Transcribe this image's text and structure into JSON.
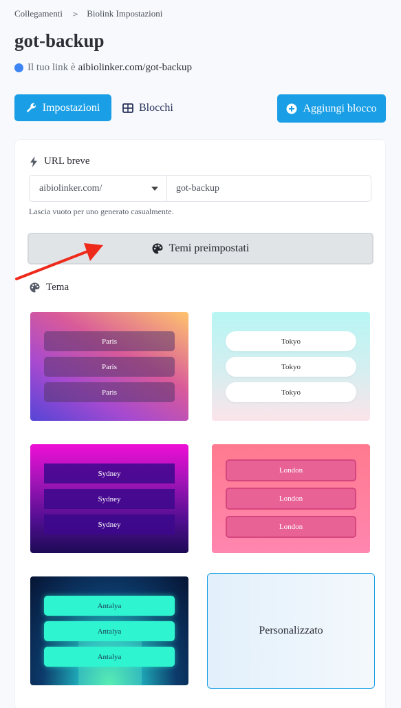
{
  "breadcrumb": {
    "parent": "Collegamenti",
    "separator": ">",
    "current": "Biolink Impostazioni"
  },
  "page": {
    "title": "got-backup",
    "link_prefix": "Il tuo link è",
    "link_url": "aibiolinker.com/got-backup",
    "status_color": "#3d84f5"
  },
  "toolbar": {
    "settings_label": "Impostazioni",
    "blocks_label": "Blocchi",
    "add_block_label": "Aggiungi blocco",
    "accent_color": "#1a9fe6"
  },
  "short_url": {
    "label": "URL breve",
    "domain": "aibiolinker.com/",
    "slug": "got-backup",
    "help": "Lascia vuoto per uno generato casualmente."
  },
  "preset_button": {
    "label": "Temi preimpostati"
  },
  "theme_section": {
    "label": "Tema"
  },
  "themes": [
    {
      "name": "Paris",
      "buttons": [
        "Paris",
        "Paris",
        "Paris"
      ]
    },
    {
      "name": "Tokyo",
      "buttons": [
        "Tokyo",
        "Tokyo",
        "Tokyo"
      ]
    },
    {
      "name": "Sydney",
      "buttons": [
        "Sydney",
        "Sydney",
        "Sydney"
      ]
    },
    {
      "name": "London",
      "buttons": [
        "London",
        "London",
        "London"
      ]
    },
    {
      "name": "Antalya",
      "buttons": [
        "Antalya",
        "Antalya",
        "Antalya"
      ]
    }
  ],
  "custom_theme": {
    "label": "Personalizzato"
  },
  "icons": {
    "settings": "wrench-icon",
    "blocks": "table-grid-icon",
    "add": "plus-circle-icon",
    "short_url": "bolt-icon",
    "palette": "palette-icon",
    "annotation": "red-arrow-icon"
  }
}
